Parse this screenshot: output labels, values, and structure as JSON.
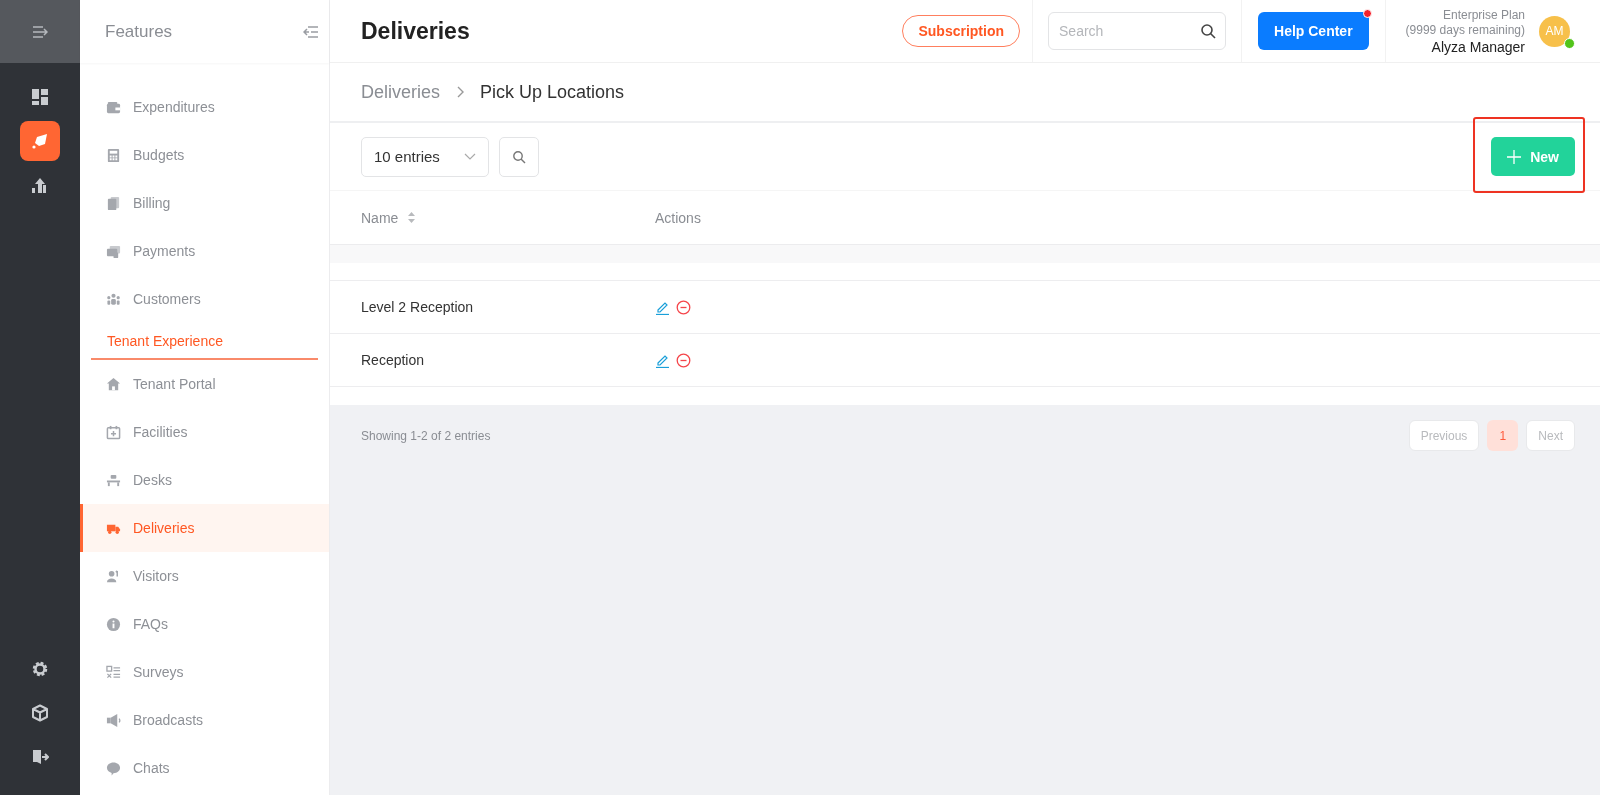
{
  "rail": {
    "items": [
      {
        "selected": false
      },
      {
        "selected": true
      },
      {
        "selected": false
      }
    ]
  },
  "sidebar": {
    "title": "Features",
    "items": [
      {
        "kind": "item",
        "label": "Expenditures",
        "selected": false
      },
      {
        "kind": "item",
        "label": "Budgets",
        "selected": false
      },
      {
        "kind": "item",
        "label": "Billing",
        "selected": false
      },
      {
        "kind": "item",
        "label": "Payments",
        "selected": false
      },
      {
        "kind": "item",
        "label": "Customers",
        "selected": false
      },
      {
        "kind": "section",
        "label": "Tenant Experience"
      },
      {
        "kind": "item",
        "label": "Tenant Portal",
        "selected": false
      },
      {
        "kind": "item",
        "label": "Facilities",
        "selected": false
      },
      {
        "kind": "item",
        "label": "Desks",
        "selected": false
      },
      {
        "kind": "item",
        "label": "Deliveries",
        "selected": true
      },
      {
        "kind": "item",
        "label": "Visitors",
        "selected": false
      },
      {
        "kind": "item",
        "label": "FAQs",
        "selected": false
      },
      {
        "kind": "item",
        "label": "Surveys",
        "selected": false
      },
      {
        "kind": "item",
        "label": "Broadcasts",
        "selected": false
      },
      {
        "kind": "item",
        "label": "Chats",
        "selected": false
      }
    ]
  },
  "header": {
    "title": "Deliveries",
    "subscription": "Subscription",
    "search": {
      "placeholder": "Search"
    },
    "help": {
      "label": "Help Center",
      "notification": true
    },
    "user": {
      "plan": "Enterprise Plan",
      "remaining": "(9999 days remaining)",
      "name": "Alyza Manager",
      "initials": "AM",
      "online": true
    }
  },
  "breadcrumb": [
    "Deliveries",
    "Pick Up Locations"
  ],
  "toolbar": {
    "entries": "10 entries",
    "new_button": {
      "label": "New",
      "highlighted": true
    }
  },
  "table": {
    "columns": [
      "Name",
      "Actions"
    ],
    "rows": [
      {
        "name": "Level 2 Reception"
      },
      {
        "name": "Reception"
      }
    ]
  },
  "footer": {
    "summary": "Showing 1-2 of 2 entries",
    "previous": "Previous",
    "pages": [
      {
        "label": "1",
        "selected": true
      }
    ],
    "next": "Next"
  }
}
